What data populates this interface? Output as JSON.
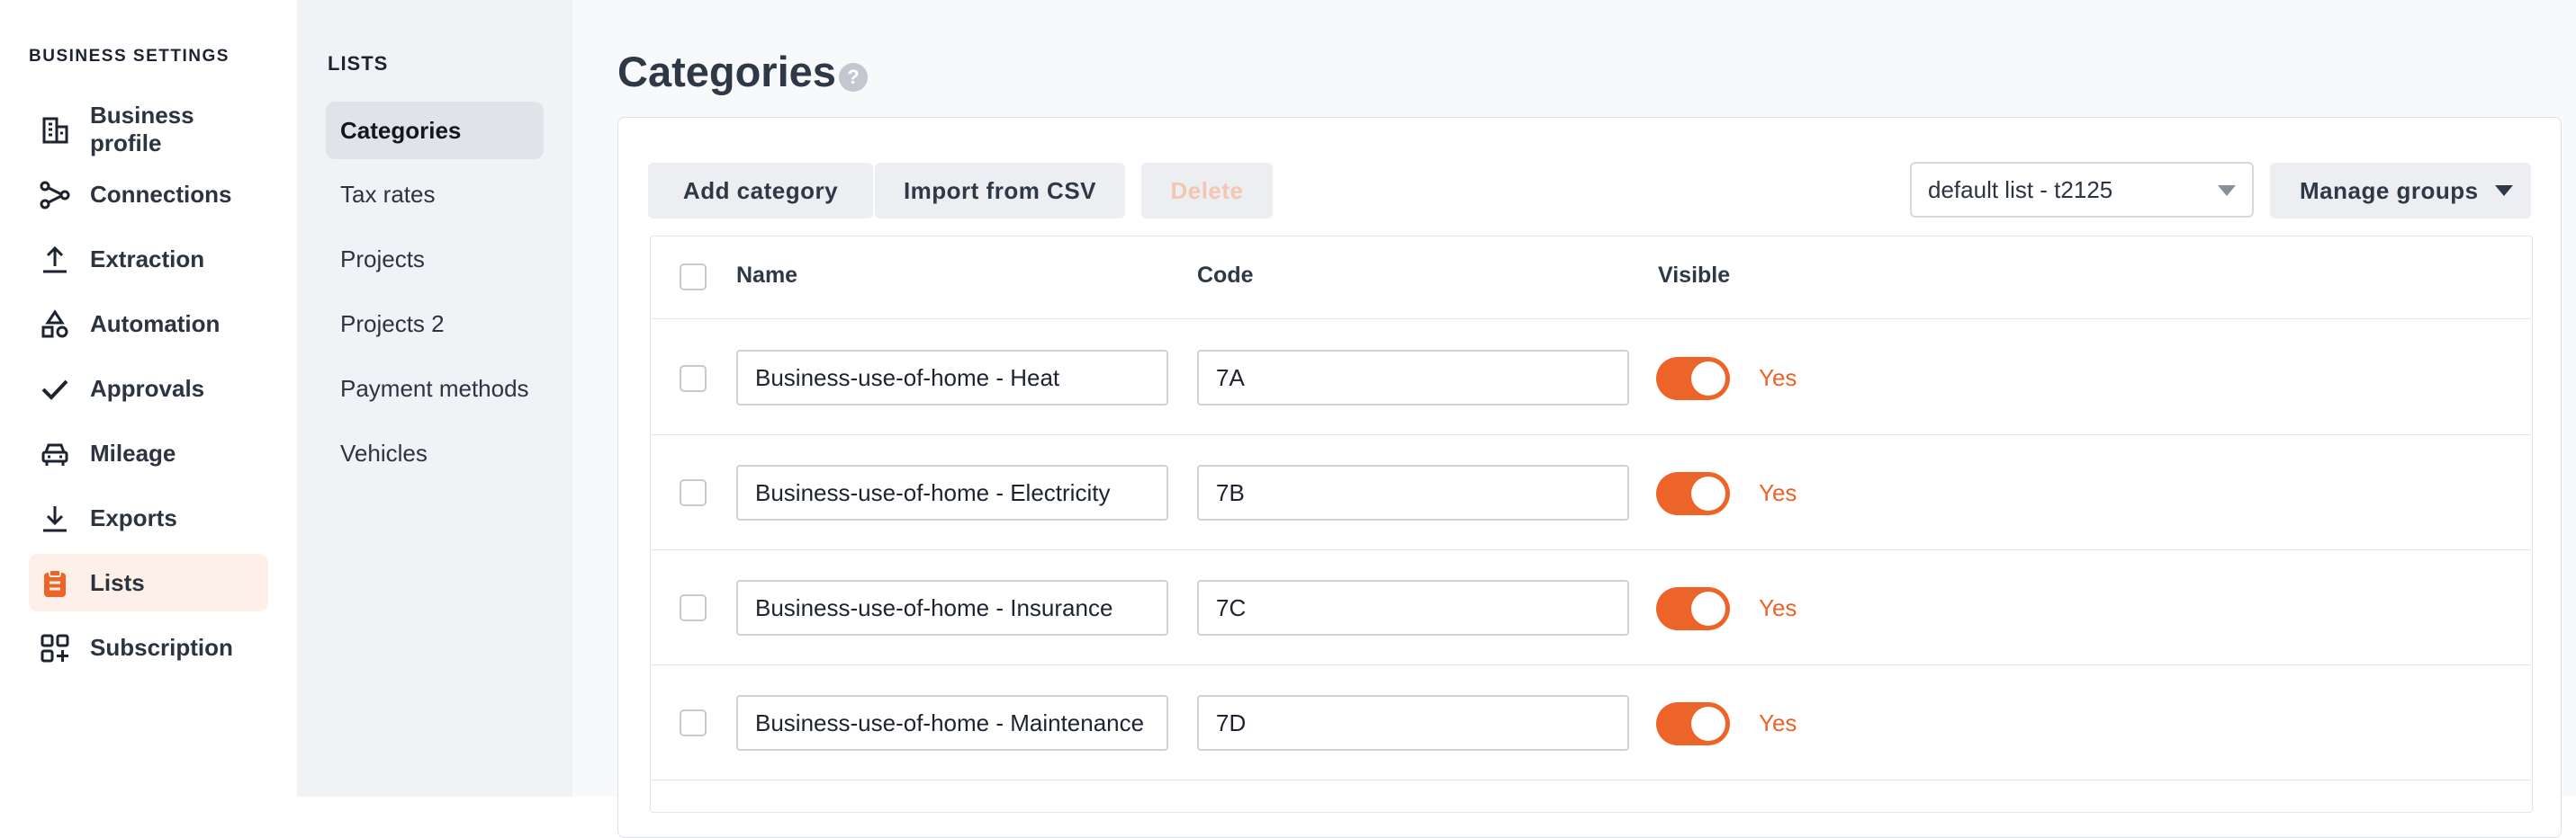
{
  "nav": {
    "heading": "BUSINESS SETTINGS",
    "items": [
      {
        "label": "Business profile",
        "icon": "building-icon",
        "active": false
      },
      {
        "label": "Connections",
        "icon": "connections-icon",
        "active": false
      },
      {
        "label": "Extraction",
        "icon": "upload-icon",
        "active": false
      },
      {
        "label": "Automation",
        "icon": "shapes-icon",
        "active": false
      },
      {
        "label": "Approvals",
        "icon": "check-icon",
        "active": false
      },
      {
        "label": "Mileage",
        "icon": "car-icon",
        "active": false
      },
      {
        "label": "Exports",
        "icon": "download-icon",
        "active": false
      },
      {
        "label": "Lists",
        "icon": "clipboard-icon",
        "active": true
      },
      {
        "label": "Subscription",
        "icon": "grid-plus-icon",
        "active": false
      }
    ]
  },
  "subnav": {
    "heading": "LISTS",
    "items": [
      {
        "label": "Categories",
        "active": true
      },
      {
        "label": "Tax rates",
        "active": false
      },
      {
        "label": "Projects",
        "active": false
      },
      {
        "label": "Projects 2",
        "active": false
      },
      {
        "label": "Payment methods",
        "active": false
      },
      {
        "label": "Vehicles",
        "active": false
      }
    ]
  },
  "main": {
    "title": "Categories",
    "help_icon": "?",
    "toolbar": {
      "add_label": "Add category",
      "import_label": "Import from CSV",
      "delete_label": "Delete",
      "list_select_value": "default list - t2125",
      "manage_groups_label": "Manage groups"
    },
    "table": {
      "headers": {
        "name": "Name",
        "code": "Code",
        "visible": "Visible"
      },
      "rows": [
        {
          "name": "Business-use-of-home - Heat",
          "code": "7A",
          "visible": "Yes"
        },
        {
          "name": "Business-use-of-home - Electricity",
          "code": "7B",
          "visible": "Yes"
        },
        {
          "name": "Business-use-of-home - Insurance",
          "code": "7C",
          "visible": "Yes"
        },
        {
          "name": "Business-use-of-home - Maintenance",
          "code": "7D",
          "visible": "Yes"
        }
      ]
    }
  },
  "colors": {
    "accent": "#ec6427",
    "active_bg": "#fdf0e8"
  }
}
